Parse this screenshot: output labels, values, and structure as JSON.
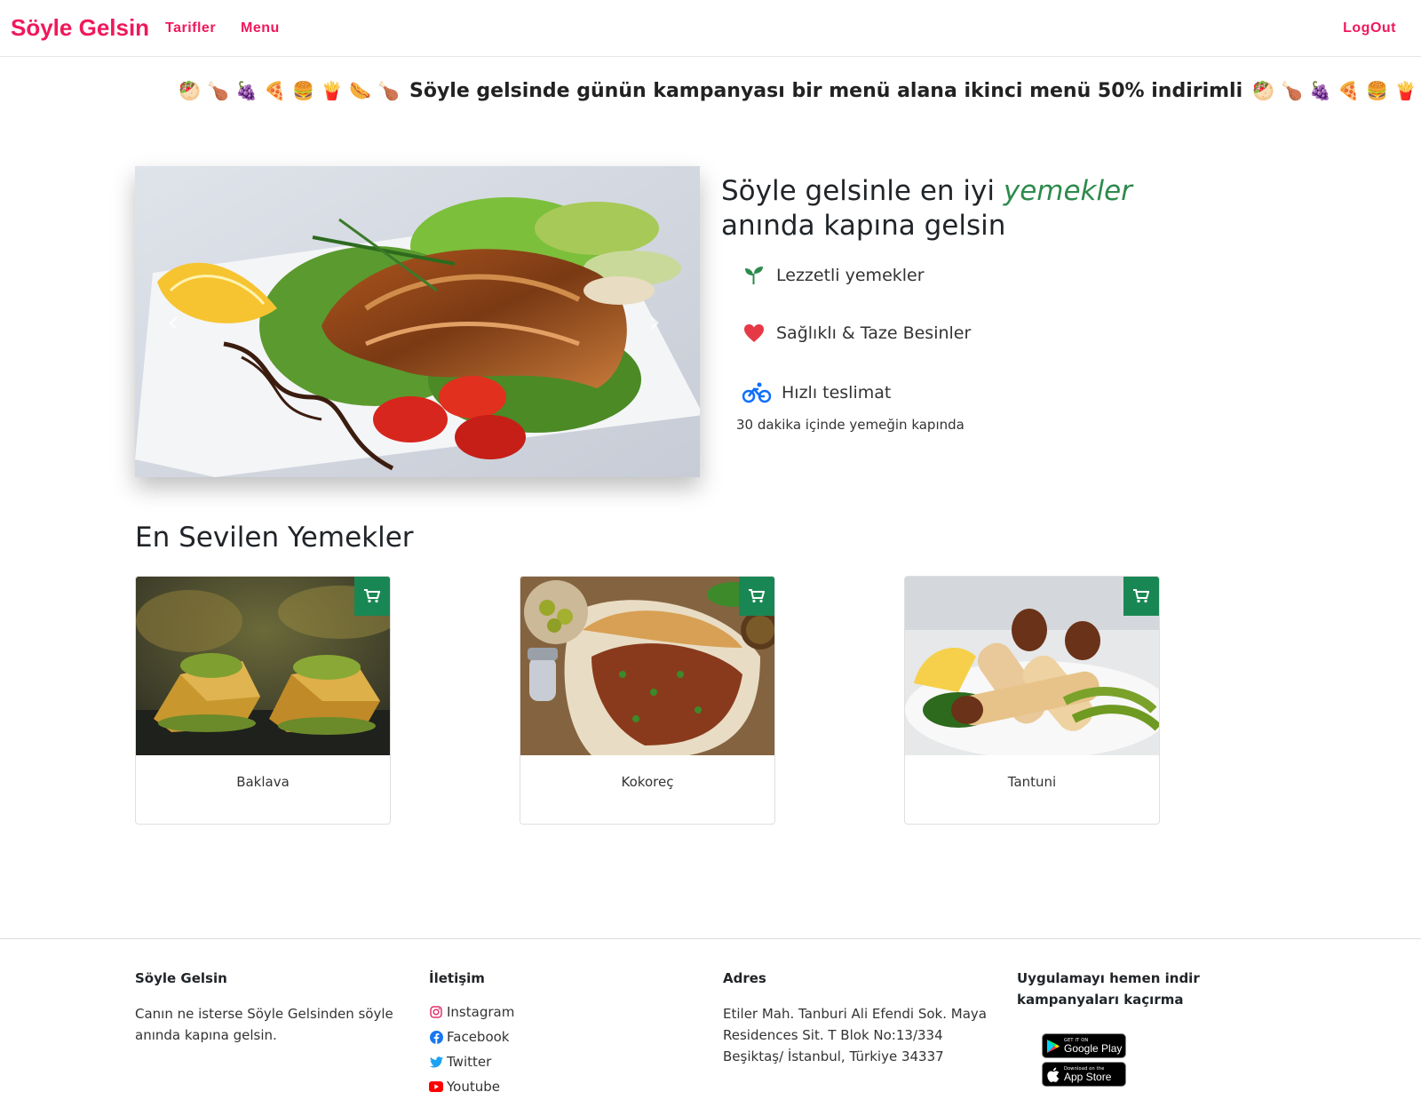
{
  "nav": {
    "brand": "Söyle Gelsin",
    "tarifler": "Tarifler",
    "menu": "Menu",
    "logout": "LogOut"
  },
  "marquee": {
    "text": "Söyle gelsinde günün kampanyası bir menü alana ikinci menü 50% indirimli",
    "emoji": [
      "🥙",
      "🍗",
      "🍇",
      "🍕",
      "🍔",
      "🍟",
      "🌭",
      "🍗"
    ]
  },
  "hero": {
    "title_pre": "Söyle gelsinle en iyi",
    "title_accent": "yemekler",
    "title_post": "anında kapına gelsin",
    "features": [
      {
        "icon": "seedling-icon",
        "label": "Lezzetli yemekler"
      },
      {
        "icon": "heart-icon",
        "label": "Sağlıklı & Taze Besinler"
      },
      {
        "icon": "bicycle-icon",
        "label": "Hızlı teslimat"
      }
    ],
    "delivery_note": "30 dakika içinde yemeğin kapında"
  },
  "popular": {
    "title": "En Sevilen Yemekler",
    "items": [
      {
        "name": "Baklava"
      },
      {
        "name": "Kokoreç"
      },
      {
        "name": "Tantuni"
      }
    ]
  },
  "footer": {
    "brand_title": "Söyle Gelsin",
    "brand_text": "Canın ne isterse Söyle Gelsinden söyle anında kapına gelsin.",
    "contact_title": "İletişim",
    "social": [
      "Instagram",
      "Facebook",
      "Twitter",
      "Youtube"
    ],
    "address_title": "Adres",
    "address": "Etiler Mah. Tanburi Ali Efendi Sok. Maya Residences Sit. T Blok No:13/334 Beşiktaş/ İstanbul, Türkiye 34337",
    "app_title": "Uygulamayı hemen indir kampanyaları kaçırma",
    "google_play": {
      "small": "GET IT ON",
      "big": "Google Play"
    },
    "app_store": {
      "small": "Download on the",
      "big": "App Store"
    }
  },
  "colors": {
    "brand": "#f0185c",
    "accent_green": "#2d8a4c",
    "cart_green": "#198754",
    "heart_red": "#e63946",
    "bike_blue": "#0d6efd"
  }
}
